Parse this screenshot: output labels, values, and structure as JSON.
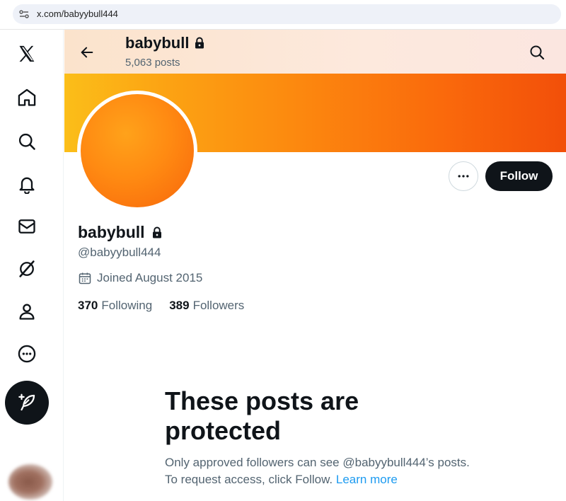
{
  "browser": {
    "url": "x.com/babyybull444"
  },
  "nav": {
    "icons": [
      "x-logo-icon",
      "home-icon",
      "search-icon",
      "bell-icon",
      "mail-icon",
      "grok-icon",
      "profile-icon",
      "more-icon",
      "post-icon"
    ]
  },
  "header": {
    "name": "babybull",
    "posts": "5,063 posts"
  },
  "profile": {
    "display_name": "babybull",
    "handle": "@babyybull444",
    "joined": "Joined August 2015",
    "following_count": "370",
    "following_label": "Following",
    "followers_count": "389",
    "followers_label": "Followers",
    "follow_label": "Follow",
    "banner_colors": [
      "#fbbe19",
      "#f24f09"
    ],
    "avatar_color": "#ff8a12"
  },
  "protected": {
    "title": "These posts are protected",
    "body": "Only approved followers can see @babyybull444’s posts. To request access, click Follow.",
    "link": "Learn more"
  },
  "colors": {
    "accent": "#1d9bf0",
    "text": "#0f1419",
    "muted": "#536471"
  }
}
